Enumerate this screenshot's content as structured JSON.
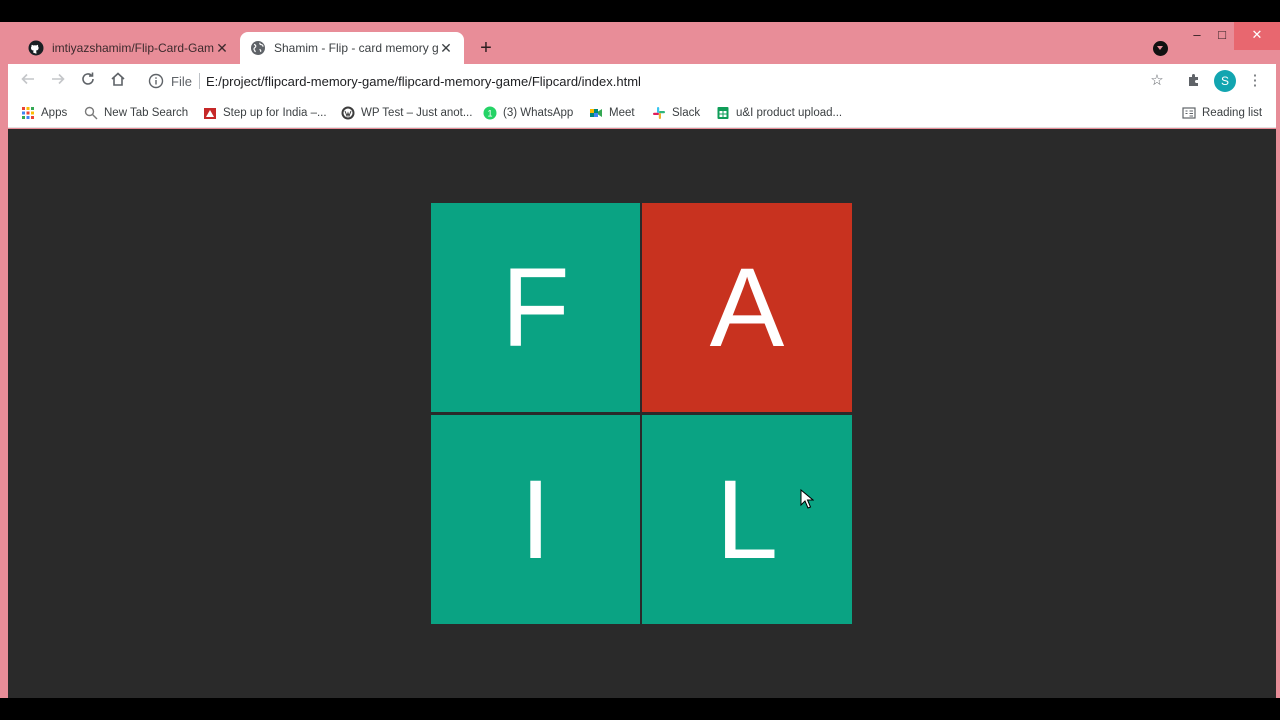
{
  "browser": {
    "tabs": [
      {
        "title": "imtiyazshamim/Flip-Card-Game",
        "favicon": "github-icon"
      },
      {
        "title": "Shamim - Flip - card memory game",
        "favicon": "globe-icon"
      }
    ],
    "new_tab_label": "+",
    "window_controls": {
      "minimize": "–",
      "maximize": "□",
      "close": "✕"
    }
  },
  "toolbar": {
    "url_scheme_label": "File",
    "url": "E:/project/flipcard-memory-game/flipcard-memory-game/Flipcard/index.html",
    "profile_initial": "S"
  },
  "bookmarks": {
    "items": [
      {
        "label": "Apps",
        "icon": "apps-grid-icon"
      },
      {
        "label": "New Tab Search",
        "icon": "search-icon"
      },
      {
        "label": "Step up for India –...",
        "icon": "india-icon"
      },
      {
        "label": "WP Test – Just anot...",
        "icon": "wordpress-icon"
      },
      {
        "label": "(3) WhatsApp",
        "icon": "whatsapp-icon"
      },
      {
        "label": "Meet",
        "icon": "meet-icon"
      },
      {
        "label": "Slack",
        "icon": "slack-icon"
      },
      {
        "label": "u&I product upload...",
        "icon": "sheets-icon"
      }
    ],
    "reading_list": "Reading list"
  },
  "game": {
    "cards": [
      {
        "letter": "F",
        "color": "#0aa383"
      },
      {
        "letter": "A",
        "color": "#c8321f"
      },
      {
        "letter": "I",
        "color": "#0aa383"
      },
      {
        "letter": "L",
        "color": "#0aa383"
      }
    ],
    "background": "#2a2a2a"
  }
}
